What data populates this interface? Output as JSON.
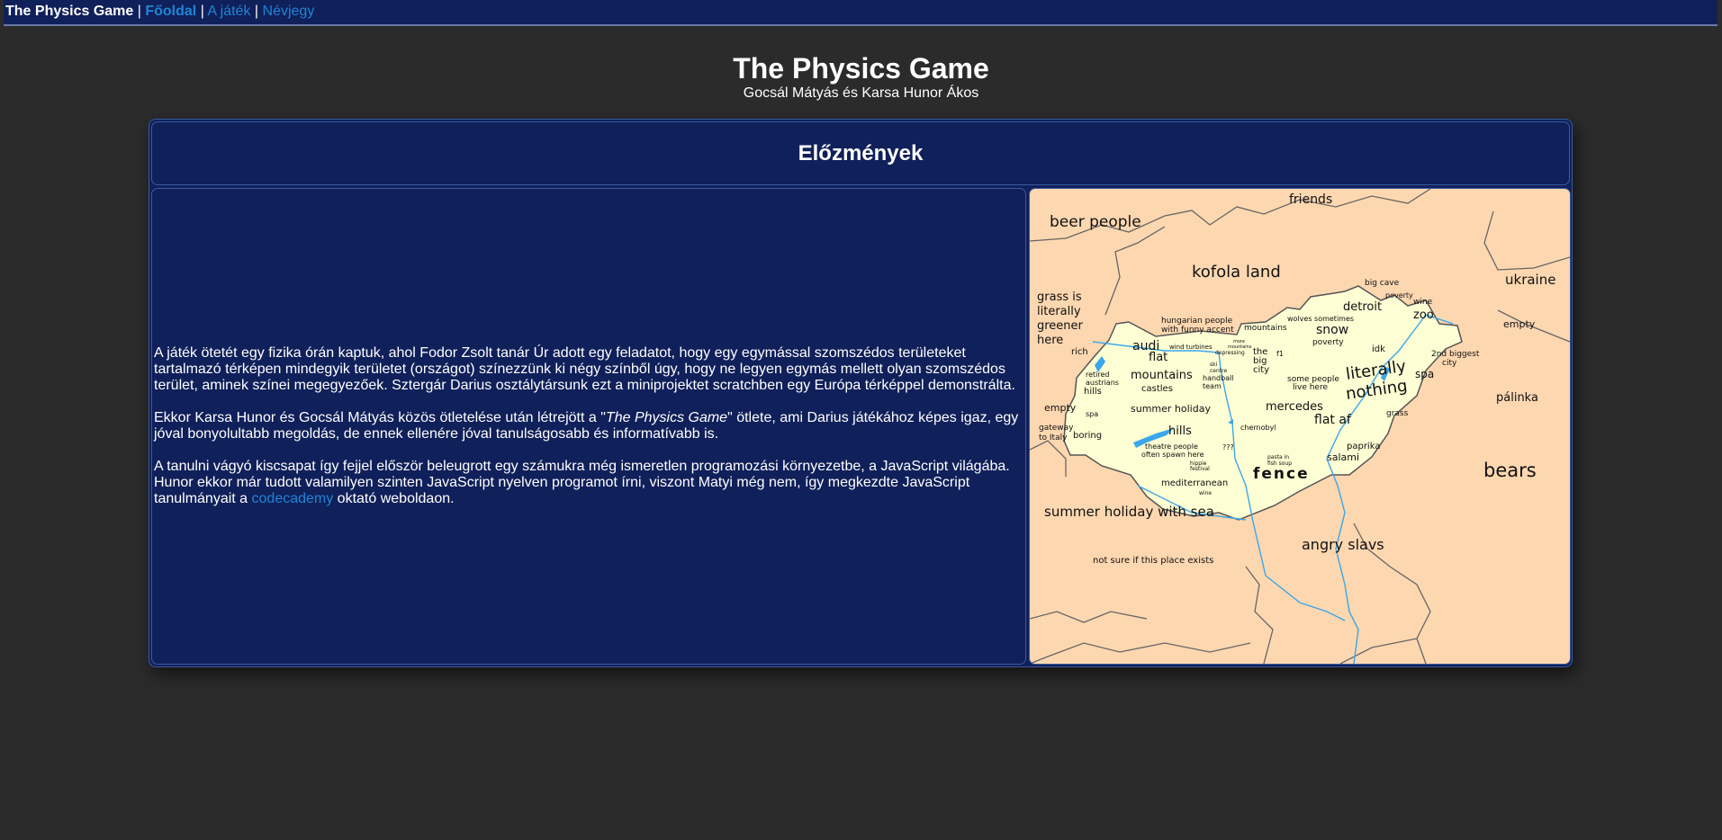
{
  "nav": {
    "brand": "The Physics Game",
    "sep": "|",
    "links": [
      "Főoldal",
      "A játék",
      "Névjegy"
    ]
  },
  "header": {
    "title": "The Physics Game",
    "subtitle": "Gocsál Mátyás és Karsa Hunor Ákos"
  },
  "section": {
    "title": "Előzmények",
    "p1": "A játék ötetét egy fizika órán kaptuk, ahol Fodor Zsolt tanár Úr adott egy feladatot, hogy egy egymással szomszédos területeket tartalmazó térképen mindegyik területet (országot) színezzünk ki négy színből úgy, hogy ne legyen egymás mellett olyan szomszédos terület, aminek színei megegyezőek. Sztergár Darius osztálytársunk ezt a miniprojektet scratchben egy Európa térképpel demonstrálta.",
    "p2_before": "Ekkor Karsa Hunor és Gocsál Mátyás közös ötletelése után létrejött a \"",
    "p2_em": "The Physics Game",
    "p2_after": "\" ötlete, ami Darius játékához képes igaz, egy jóval bonyolultabb megoldás, de ennek ellenére jóval tanulságosabb és informatívabb is.",
    "p3_before": "A tanulni vágyó kiscsapat így fejjel először beleugrott egy számukra még ismeretlen programozási környezetbe, a JavaScript világába. Hunor ekkor már tudott valamilyen szinten JavaScript nyelven programot írni, viszont Matyi még nem, így megkezdte JavaScript tanulmányait a ",
    "p3_link": "codecademy",
    "p3_after": " oktató weboldaon."
  },
  "map": {
    "colors": {
      "outside": "#fdd7b0",
      "hungary": "#fefed4",
      "water": "#3aa7ea",
      "border": "#666666"
    },
    "outside_labels": [
      "friends",
      "beer people",
      "kofola land",
      "ukraine",
      "grass is",
      "literally",
      "greener",
      "here",
      "empty",
      "pálinka",
      "bears",
      "gateway",
      "to Italy",
      "summer holiday with sea",
      "angry slavs",
      "not sure if this place exists"
    ],
    "inside_labels": [
      "big cave",
      "poverty",
      "wine",
      "detroit",
      "zoo",
      "hungarian people",
      "with funny accent",
      "mountains",
      "wolves sometimes",
      "snow",
      "poverty",
      "idk",
      "2nd biggest",
      "city",
      "spa",
      "audi",
      "wind turbines",
      "more",
      "mountains",
      "depressing",
      "the",
      "big",
      "city",
      "f1",
      "rich",
      "flat",
      "ski",
      "centre",
      "retired",
      "austrians",
      "mountains",
      "castles",
      "handball",
      "team",
      "some people",
      "live here",
      "literally",
      "nothing",
      "hills",
      "empty",
      "spa",
      "summer holiday",
      "mercedes",
      "grass",
      "flat af",
      "boring",
      "hills",
      "chernobyl",
      "theatre people",
      "often spawn here",
      "???",
      "paprika",
      "hippie",
      "festival",
      "pasta in",
      "fish soup",
      "salami",
      "mediterranean",
      "wine",
      "fence"
    ]
  }
}
